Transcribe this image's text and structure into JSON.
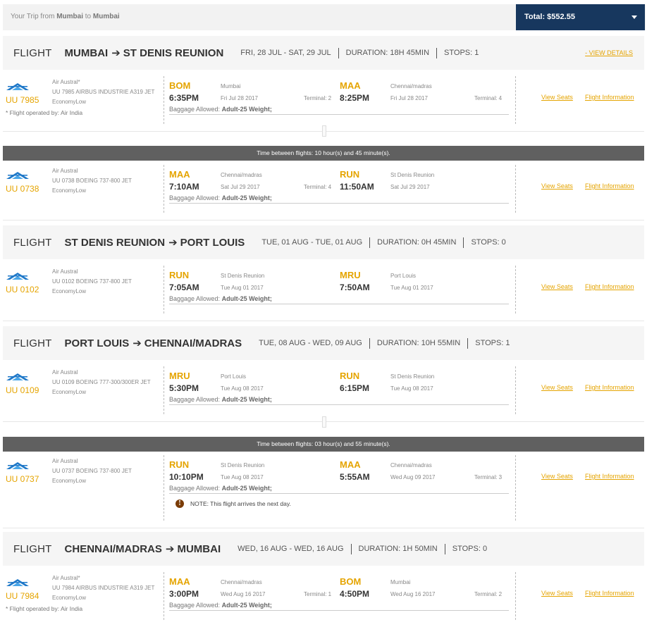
{
  "trip": {
    "prefix": "Your Trip from",
    "from": "Mumbai",
    "to_word": "to",
    "to": "Mumbai",
    "total_label": "Total: $552.55"
  },
  "colors": {
    "accent": "#e5a400",
    "navy": "#17375e",
    "layover_bar": "#606060"
  },
  "view_details": "- VIEW DETAILS",
  "seat_label": "View Seats",
  "info_label": "Flight Information",
  "flights": [
    {
      "label": "FLIGHT",
      "from": "MUMBAI",
      "to": "ST DENIS REUNION",
      "dates": "FRI, 28 JUL - SAT, 29 JUL",
      "duration": "DURATION: 18H 45MIN",
      "stops": "STOPS: 1",
      "segments": [
        {
          "airline": "Air Austral*",
          "equipment": "UU 7985 AIRBUS INDUSTRIE A319 JET",
          "cabin": "EconomyLow",
          "flight_no": "UU 7985",
          "operated_by": "* Flight operated by: Air India",
          "logo_icon": "air-austral-logo",
          "dep": {
            "code": "BOM",
            "time": "6:35PM",
            "city": "Mumbai",
            "date": "Fri Jul 28 2017",
            "terminal": "Terminal: 2"
          },
          "arr": {
            "code": "MAA",
            "time": "8:25PM",
            "city": "Chennai/madras",
            "date": "Fri Jul 28 2017",
            "terminal": "Terminal: 4"
          },
          "baggage_label": "Baggage Allowed:",
          "baggage": "Adult-25 Weight;"
        },
        {
          "airline": "Air Austral",
          "equipment": "UU 0738 BOEING 737-800 JET",
          "cabin": "EconomyLow",
          "flight_no": "UU 0738",
          "logo_icon": "air-austral-logo",
          "dep": {
            "code": "MAA",
            "time": "7:10AM",
            "city": "Chennai/madras",
            "date": "Sat Jul 29 2017",
            "terminal": "Terminal: 4"
          },
          "arr": {
            "code": "RUN",
            "time": "11:50AM",
            "city": "St Denis Reunion",
            "date": "Sat Jul 29 2017",
            "terminal": ""
          },
          "baggage_label": "Baggage Allowed:",
          "baggage": "Adult-25 Weight;"
        }
      ],
      "layover": "Time between flights: 10 hour(s) and 45 minute(s)."
    },
    {
      "label": "FLIGHT",
      "from": "ST DENIS REUNION",
      "to": "PORT LOUIS",
      "dates": "TUE, 01 AUG - TUE, 01 AUG",
      "duration": "DURATION: 0H 45MIN",
      "stops": "STOPS: 0",
      "segments": [
        {
          "airline": "Air Austral",
          "equipment": "UU 0102 BOEING 737-800 JET",
          "cabin": "EconomyLow",
          "flight_no": "UU 0102",
          "logo_icon": "air-austral-logo",
          "dep": {
            "code": "RUN",
            "time": "7:05AM",
            "city": "St Denis Reunion",
            "date": "Tue Aug 01 2017",
            "terminal": ""
          },
          "arr": {
            "code": "MRU",
            "time": "7:50AM",
            "city": "Port Louis",
            "date": "Tue Aug 01 2017",
            "terminal": ""
          },
          "baggage_label": "Baggage Allowed:",
          "baggage": "Adult-25 Weight;"
        }
      ]
    },
    {
      "label": "FLIGHT",
      "from": "PORT LOUIS",
      "to": "CHENNAI/MADRAS",
      "dates": "TUE, 08 AUG - WED, 09 AUG",
      "duration": "DURATION: 10H 55MIN",
      "stops": "STOPS: 1",
      "segments": [
        {
          "airline": "Air Austral",
          "equipment": "UU 0109 BOEING 777-300/300ER JET",
          "cabin": "EconomyLow",
          "flight_no": "UU 0109",
          "logo_icon": "air-austral-logo",
          "dep": {
            "code": "MRU",
            "time": "5:30PM",
            "city": "Port Louis",
            "date": "Tue Aug 08 2017",
            "terminal": ""
          },
          "arr": {
            "code": "RUN",
            "time": "6:15PM",
            "city": "St Denis Reunion",
            "date": "Tue Aug 08 2017",
            "terminal": ""
          },
          "baggage_label": "Baggage Allowed:",
          "baggage": "Adult-25 Weight;"
        },
        {
          "airline": "Air Austral",
          "equipment": "UU 0737 BOEING 737-800 JET",
          "cabin": "EconomyLow",
          "flight_no": "UU 0737",
          "logo_icon": "air-austral-logo",
          "dep": {
            "code": "RUN",
            "time": "10:10PM",
            "city": "St Denis Reunion",
            "date": "Tue Aug 08 2017",
            "terminal": ""
          },
          "arr": {
            "code": "MAA",
            "time": "5:55AM",
            "city": "Chennai/madras",
            "date": "Wed Aug 09 2017",
            "terminal": "Terminal: 3"
          },
          "baggage_label": "Baggage Allowed:",
          "baggage": "Adult-25 Weight;",
          "note": "NOTE: This flight arrives the next day."
        }
      ],
      "layover": "Time between flights: 03 hour(s) and 55 minute(s)."
    },
    {
      "label": "FLIGHT",
      "from": "CHENNAI/MADRAS",
      "to": "MUMBAI",
      "dates": "WED, 16 AUG - WED, 16 AUG",
      "duration": "DURATION: 1H 50MIN",
      "stops": "STOPS: 0",
      "segments": [
        {
          "airline": "Air Austral*",
          "equipment": "UU 7984 AIRBUS INDUSTRIE A319 JET",
          "cabin": "EconomyLow",
          "flight_no": "UU 7984",
          "operated_by": "* Flight operated by: Air India",
          "logo_icon": "air-austral-logo",
          "dep": {
            "code": "MAA",
            "time": "3:00PM",
            "city": "Chennai/madras",
            "date": "Wed Aug 16 2017",
            "terminal": "Terminal: 1"
          },
          "arr": {
            "code": "BOM",
            "time": "4:50PM",
            "city": "Mumbai",
            "date": "Wed Aug 16 2017",
            "terminal": "Terminal: 2"
          },
          "baggage_label": "Baggage Allowed:",
          "baggage": "Adult-25 Weight;"
        }
      ]
    }
  ]
}
